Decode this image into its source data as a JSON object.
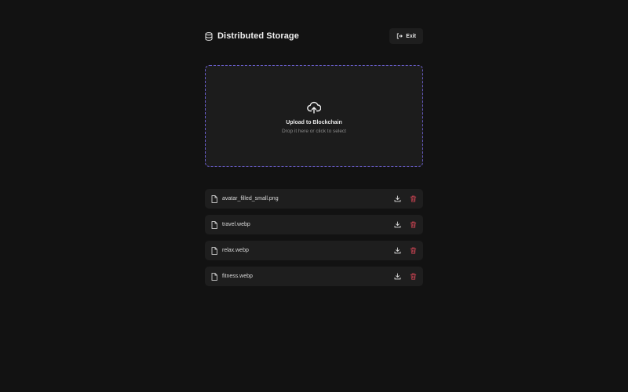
{
  "header": {
    "title": "Distributed Storage",
    "icon": "database-icon",
    "exit_label": "Exit",
    "exit_icon": "log-out-icon"
  },
  "dropzone": {
    "icon": "cloud-upload-icon",
    "title": "Upload to Blockchain",
    "subtitle": "Drop it here or click to select",
    "border_color": "#6b5fd0"
  },
  "files": [
    {
      "name": "avatar_filled_small.png"
    },
    {
      "name": "travel.webp"
    },
    {
      "name": "relax.webp"
    },
    {
      "name": "fitness.webp"
    }
  ],
  "colors": {
    "background": "#121212",
    "card": "#1e1e1e",
    "delete": "#c0414f",
    "accent": "#6b5fd0"
  }
}
